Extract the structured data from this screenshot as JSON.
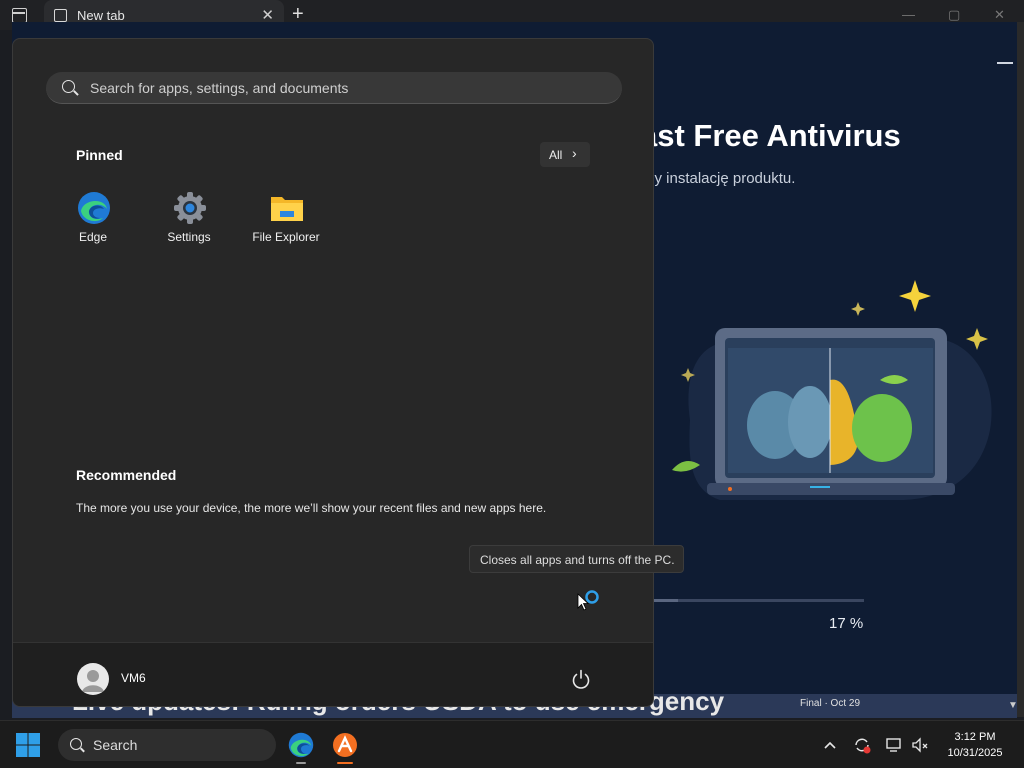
{
  "browser": {
    "tab_title": "New tab",
    "close_glyph": "✕",
    "new_tab_glyph": "+"
  },
  "installer": {
    "title_partial": "ast Free Antivirus",
    "subtitle_partial": "my instalację produktu.",
    "progress_percent": 17,
    "progress_label": "17 %"
  },
  "background_news": {
    "headline_partial": "Live updates: Ruling orders USDA to use emergency",
    "score_label": "Final · Oct 29"
  },
  "start_menu": {
    "search_placeholder": "Search for apps, settings, and documents",
    "pinned_title": "Pinned",
    "all_button_label": "All",
    "all_button_chevron": "›",
    "pinned": [
      {
        "label": "Edge",
        "icon": "edge-icon"
      },
      {
        "label": "Settings",
        "icon": "gear-icon"
      },
      {
        "label": "File Explorer",
        "icon": "folder-icon"
      }
    ],
    "recommended_title": "Recommended",
    "recommended_text": "The more you use your device, the more we’ll show your recent files and new apps here.",
    "user_name": "VM6",
    "power_tooltip": "Closes all apps and turns off the PC."
  },
  "taskbar": {
    "search_label": "Search",
    "time": "3:12 PM",
    "date": "10/31/2025"
  },
  "colors": {
    "start_bg": "#272727",
    "taskbar_bg": "#1c1c1c",
    "windows_blue": "#2f9fe8",
    "avast_orange": "#f36f21",
    "installer_bg": "#0f1c33"
  }
}
